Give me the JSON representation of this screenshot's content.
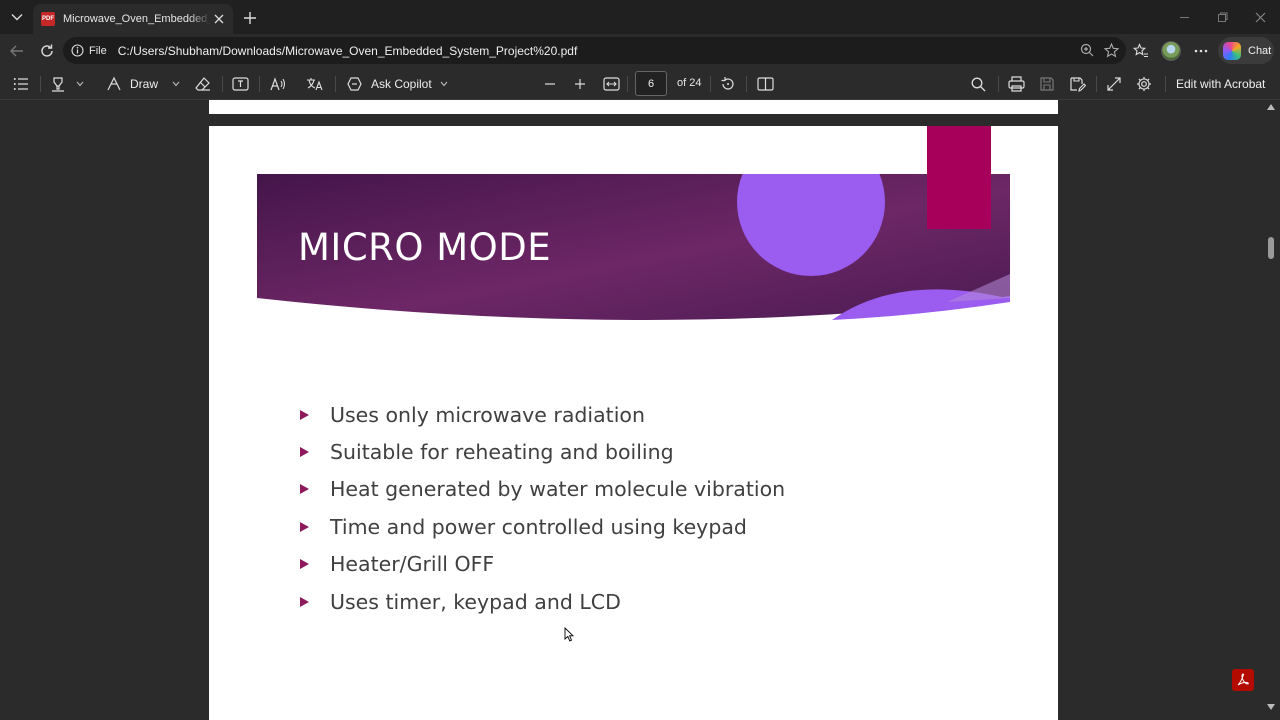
{
  "browser": {
    "tab": {
      "title": "Microwave_Oven_Embedded_System_Project%20.pdf",
      "favicon": "PDF"
    },
    "address": {
      "file_label": "File",
      "url": "C:/Users/Shubham/Downloads/Microwave_Oven_Embedded_System_Project%20.pdf"
    },
    "chat_label": "Chat"
  },
  "pdf_toolbar": {
    "draw_label": "Draw",
    "copilot_label": "Ask Copilot",
    "page_current": "6",
    "page_total": "of 24",
    "acrobat_label": "Edit with Acrobat"
  },
  "slide": {
    "title": "MICRO MODE",
    "bullets": [
      "Uses only microwave radiation",
      "Suitable for reheating and boiling",
      "Heat generated by water molecule vibration",
      "Time and power controlled using keypad",
      "Heater/Grill OFF",
      "Uses timer, keypad and LCD"
    ],
    "colors": {
      "banner": "#5a2358",
      "accent": "#a6005a",
      "circle": "#9b5cf0",
      "bullet": "#8e1a5e"
    }
  }
}
